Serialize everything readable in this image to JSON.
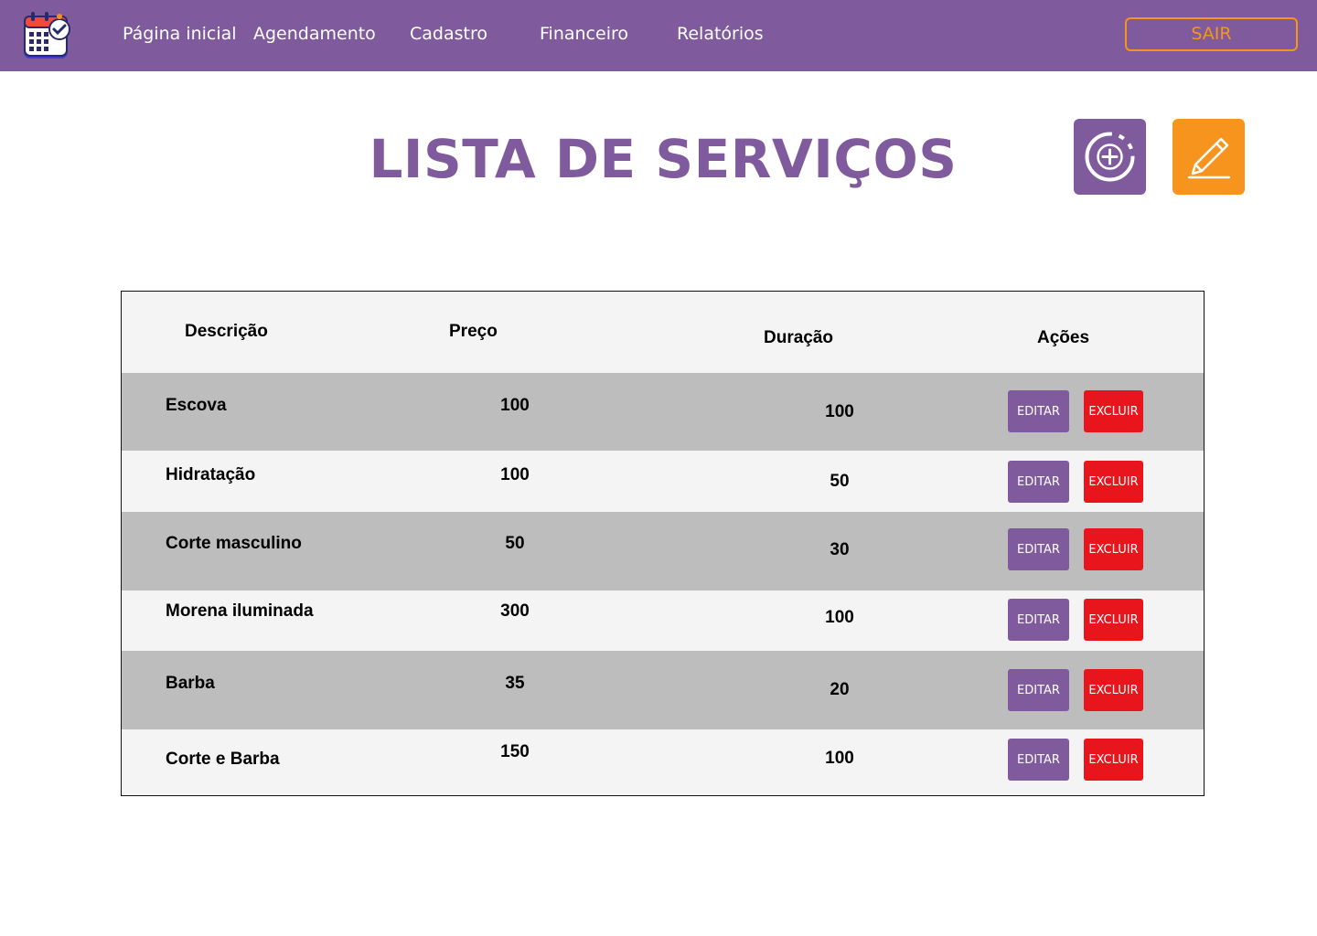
{
  "nav": {
    "items": [
      "Página inicial",
      "Agendamento",
      "Cadastro",
      "Financeiro",
      "Relatórios"
    ],
    "logout_label": "SAIR",
    "logo_icon": "calendar-check-icon"
  },
  "header": {
    "title": "LISTA DE SERVIÇOS",
    "add_icon": "plus-circle-icon",
    "edit_icon": "pencil-icon"
  },
  "table": {
    "columns": [
      "Descrição",
      "Preço",
      "Duração",
      "Ações"
    ],
    "rows": [
      {
        "descricao": "Escova",
        "preco": "100",
        "duracao": "100"
      },
      {
        "descricao": "Hidratação",
        "preco": "100",
        "duracao": "50"
      },
      {
        "descricao": "Corte masculino",
        "preco": "50",
        "duracao": "30"
      },
      {
        "descricao": "Morena iluminada",
        "preco": "300",
        "duracao": "100"
      },
      {
        "descricao": "Barba",
        "preco": "35",
        "duracao": "20"
      },
      {
        "descricao": "Corte e Barba",
        "preco": "150",
        "duracao": "100"
      }
    ],
    "edit_label": "EDITAR",
    "delete_label": "EXCLUIR"
  },
  "colors": {
    "primary": "#7f5a9c",
    "accent": "#f7941d",
    "danger": "#e8161c",
    "row_gray": "#bdbdbd",
    "row_light": "#f4f4f4"
  }
}
